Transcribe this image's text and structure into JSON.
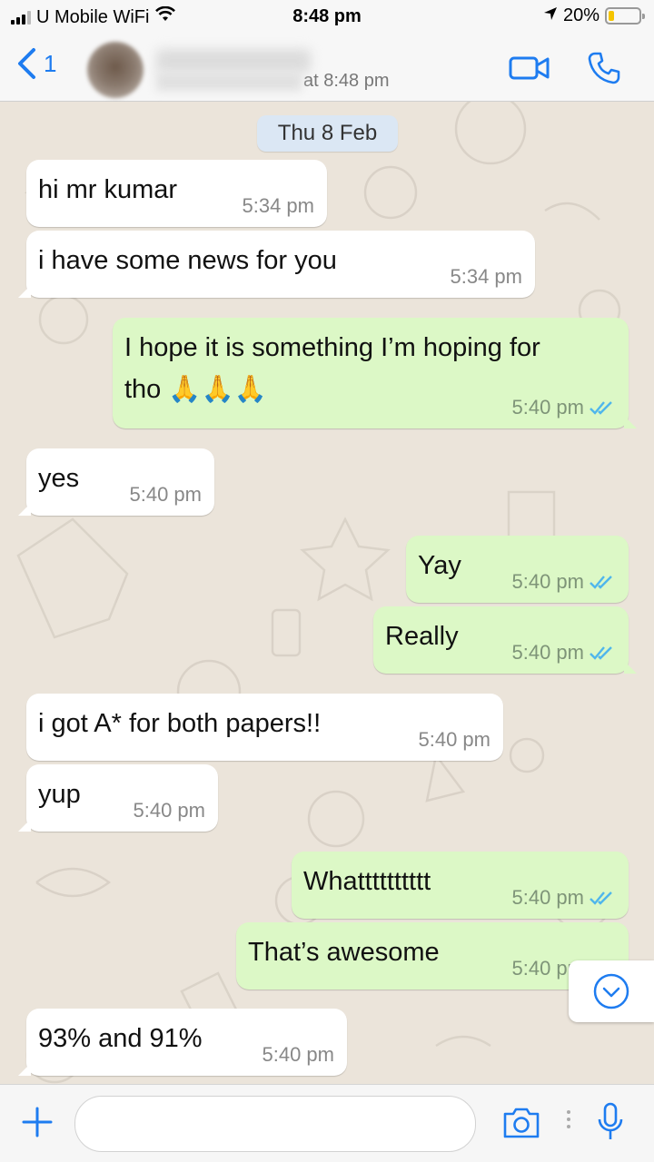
{
  "status_bar": {
    "carrier": "U Mobile WiFi",
    "time": "8:48 pm",
    "battery": "20%",
    "battery_level": 0.2
  },
  "header": {
    "back_count": "1",
    "last_seen": "at 8:48 pm"
  },
  "date_separator": "Thu 8 Feb",
  "messages": [
    {
      "direction": "in",
      "text": "hi mr kumar",
      "time": "5:34 pm"
    },
    {
      "direction": "in",
      "text": "i have some news for you",
      "time": "5:34 pm"
    },
    {
      "direction": "out",
      "text_line1": "I hope it is something I’m hoping for",
      "text_line2": "tho 🙏🙏🙏",
      "time": "5:40 pm",
      "status": "read"
    },
    {
      "direction": "in",
      "text": "yes",
      "time": "5:40 pm"
    },
    {
      "direction": "out",
      "text": "Yay",
      "time": "5:40 pm",
      "status": "read"
    },
    {
      "direction": "out",
      "text": "Really",
      "time": "5:40 pm",
      "status": "read"
    },
    {
      "direction": "in",
      "text": "i got A* for both papers!!",
      "time": "5:40 pm"
    },
    {
      "direction": "in",
      "text": "yup",
      "time": "5:40 pm"
    },
    {
      "direction": "out",
      "text": "Whatttttttttt",
      "time": "5:40 pm",
      "status": "read"
    },
    {
      "direction": "out",
      "text": "That’s awesome",
      "time": "5:40 pm",
      "status": "read"
    },
    {
      "direction": "in",
      "text": "93% and 91%",
      "time": "5:40 pm"
    }
  ],
  "input": {
    "placeholder": ""
  },
  "colors": {
    "accent": "#1e7cf0",
    "outgoing_bubble": "#dcf8c6",
    "incoming_bubble": "#ffffff",
    "read_ticks": "#4fb6ec",
    "date_pill": "#dbe7f4"
  },
  "icons": [
    "back-chevron-icon",
    "video-call-icon",
    "phone-icon",
    "scroll-down-icon",
    "plus-icon",
    "camera-icon",
    "microphone-icon",
    "read-ticks-icon",
    "wifi-icon",
    "location-arrow-icon"
  ]
}
